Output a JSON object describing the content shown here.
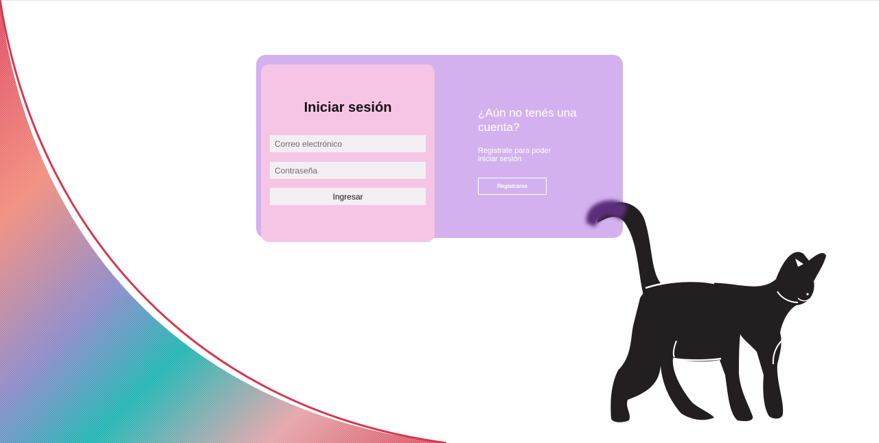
{
  "login": {
    "title": "Iniciar sesión",
    "email_placeholder": "Correo electrónico",
    "password_placeholder": "Contraseña",
    "submit_label": "Ingresar"
  },
  "signup_promo": {
    "title": "¿Aún no tenés una cuenta?",
    "text": "Registrate para poder iniciar sesión",
    "button_label": "Registrarse"
  },
  "colors": {
    "card_background": "#d3b1ee",
    "login_panel": "#f6c5e5",
    "input_background": "#f1eff2",
    "cat": "#231f20",
    "tail_tip": "#5a2e78"
  },
  "icons": {
    "decorative_swoosh": "gradient-swoosh",
    "mascot": "black-cat"
  }
}
